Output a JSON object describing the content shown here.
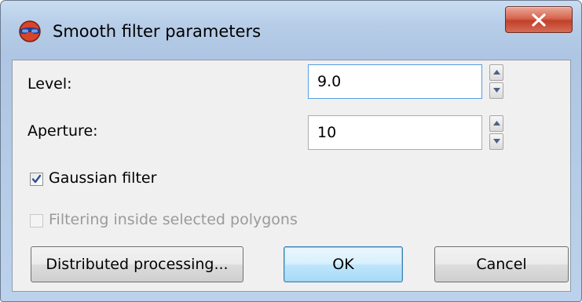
{
  "window": {
    "title": "Smooth filter parameters",
    "app_icon": "glasses-icon",
    "close_icon": "close-icon",
    "accent": "#c2402a"
  },
  "level": {
    "label": "Level:",
    "value": "9.0"
  },
  "aperture": {
    "label": "Aperture:",
    "value": "10"
  },
  "gaussian_filter": {
    "label": "Gaussian filter",
    "checked": true
  },
  "filter_inside_polygons": {
    "label": "Filtering inside selected polygons",
    "checked": false,
    "disabled": true
  },
  "buttons": {
    "distributed": "Distributed processing...",
    "ok": "OK",
    "cancel": "Cancel"
  }
}
